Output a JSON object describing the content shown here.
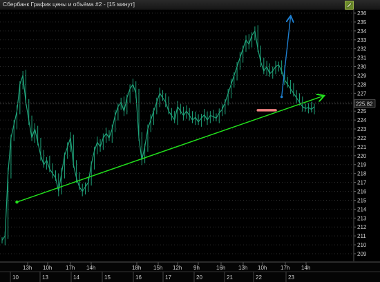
{
  "window": {
    "title": "Сбербанк График цены и объёма #2 - [15 минут]"
  },
  "colors": {
    "background": "#000000",
    "candles": "#1fa37a",
    "trendline": "#22e01c",
    "arrow_up": "#1e7fd0",
    "support_mark": "#f08080",
    "grid": "#2c2c2c",
    "axis_text": "#cfcfcf"
  },
  "chart_data": {
    "type": "line",
    "title": "",
    "y_axis": {
      "min": 209,
      "max": 236,
      "ticks": [
        209,
        210,
        211,
        212,
        213,
        214,
        215,
        216,
        217,
        218,
        219,
        220,
        221,
        222,
        223,
        224,
        225,
        226,
        227,
        228,
        229,
        230,
        231,
        232,
        233,
        234,
        235,
        236
      ]
    },
    "current_price": "225.82",
    "x_time_labels": [
      "13h",
      "10h",
      "17h",
      "14h",
      "18h",
      "15h",
      "12h",
      "9h",
      "16h",
      "13h",
      "10h",
      "17h",
      "14h"
    ],
    "x_date_labels": [
      "10",
      "13",
      "14",
      "15",
      "16",
      "17",
      "20",
      "21",
      "22",
      "23"
    ],
    "series": [
      {
        "values": [
          210.5,
          211,
          218,
          222,
          223.5,
          225,
          228,
          229,
          226,
          224,
          222,
          223,
          221.5,
          220,
          219,
          219.5,
          218.5,
          218,
          217.5,
          216,
          218,
          220,
          221,
          222,
          219,
          217.5,
          216.5,
          216,
          216.5,
          217,
          219,
          220.5,
          221.5,
          221,
          222,
          222.5,
          222,
          223,
          224.5,
          225.5,
          226,
          225,
          226.5,
          227.5,
          228,
          227,
          222,
          219.5,
          221,
          223,
          224,
          225,
          226,
          227,
          226.5,
          226,
          225,
          224.5,
          224,
          225.5,
          225,
          224.5,
          225,
          224.5,
          224,
          224.3,
          223.8,
          224.2,
          224.6,
          224,
          224.5,
          224.4,
          224.2,
          224.8,
          225.2,
          226,
          227,
          228,
          229,
          230,
          231,
          232,
          233,
          232.5,
          233.5,
          234,
          232,
          230.5,
          229.5,
          230,
          229.2,
          229.5,
          230,
          230.2,
          229.5,
          228.5,
          228,
          227.5,
          227,
          226.5,
          226,
          225.5,
          225.3,
          225.4,
          225.2,
          225.5
        ]
      }
    ],
    "annotations": [
      {
        "kind": "trendline",
        "from": {
          "x_index": 5,
          "y": 214.8
        },
        "to": {
          "x_index": 108,
          "y": 226.7
        }
      },
      {
        "kind": "forecast-arrow",
        "from": {
          "x_index": 94,
          "y": 226.6
        },
        "to": {
          "x_index": 97,
          "y": 235.6
        }
      },
      {
        "kind": "support-mark",
        "x_range_index": [
          86,
          92
        ],
        "y": 225.1
      }
    ]
  }
}
